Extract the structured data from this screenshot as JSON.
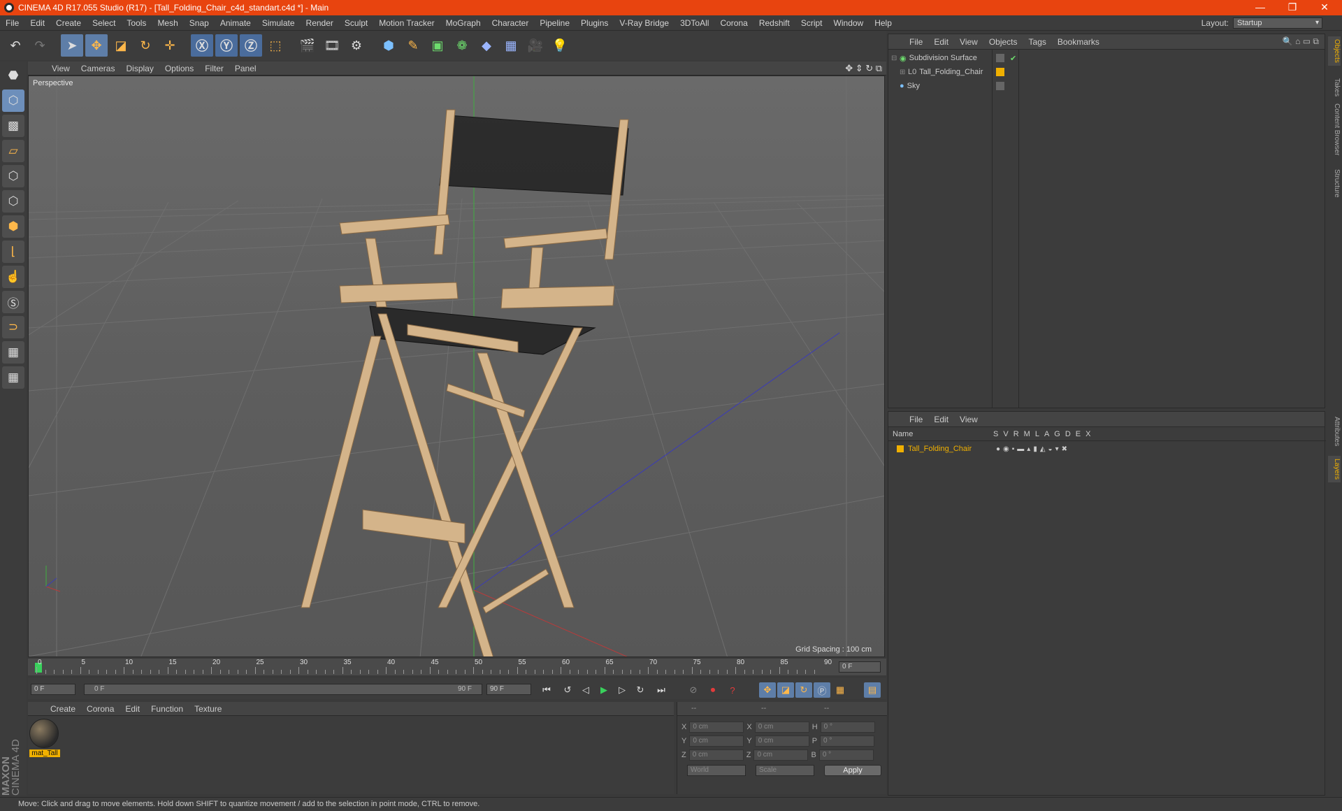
{
  "window": {
    "title": "CINEMA 4D R17.055 Studio (R17) - [Tall_Folding_Chair_c4d_standart.c4d *] - Main",
    "minimize": "—",
    "restore": "❐",
    "close": "✕"
  },
  "menu": [
    "File",
    "Edit",
    "Create",
    "Select",
    "Tools",
    "Mesh",
    "Snap",
    "Animate",
    "Simulate",
    "Render",
    "Sculpt",
    "Motion Tracker",
    "MoGraph",
    "Character",
    "Pipeline",
    "Plugins",
    "V-Ray Bridge",
    "3DToAll",
    "Corona",
    "Redshift",
    "Script",
    "Window",
    "Help"
  ],
  "layout": {
    "label": "Layout:",
    "value": "Startup"
  },
  "viewport": {
    "menu": [
      "View",
      "Cameras",
      "Display",
      "Options",
      "Filter",
      "Panel"
    ],
    "label": "Perspective",
    "grid_spacing": "Grid Spacing : 100 cm"
  },
  "timeline": {
    "ticks": [
      "0",
      "5",
      "10",
      "15",
      "20",
      "25",
      "30",
      "35",
      "40",
      "45",
      "50",
      "55",
      "60",
      "65",
      "70",
      "75",
      "80",
      "85",
      "90"
    ],
    "current_frame": "0 F",
    "start_field": "0 F",
    "range_start": "0 F",
    "range_end": "90 F",
    "end_field": "90 F"
  },
  "materials": {
    "menu": [
      "Create",
      "Corona",
      "Edit",
      "Function",
      "Texture"
    ],
    "items": [
      {
        "name": "mat_Tall"
      }
    ]
  },
  "coords": {
    "headers": [
      "--",
      "--",
      "--"
    ],
    "rows": [
      {
        "a": "X",
        "v1": "0 cm",
        "b": "X",
        "v2": "0 cm",
        "c": "H",
        "v3": "0 °"
      },
      {
        "a": "Y",
        "v1": "0 cm",
        "b": "Y",
        "v2": "0 cm",
        "c": "P",
        "v3": "0 °"
      },
      {
        "a": "Z",
        "v1": "0 cm",
        "b": "Z",
        "v2": "0 cm",
        "c": "B",
        "v3": "0 °"
      }
    ],
    "world": "World",
    "scale": "Scale",
    "apply": "Apply"
  },
  "objects": {
    "menu": [
      "File",
      "Edit",
      "View",
      "Objects",
      "Tags",
      "Bookmarks"
    ],
    "items": [
      {
        "name": "Subdivision Surface"
      },
      {
        "name": "Tall_Folding_Chair"
      },
      {
        "name": "Sky"
      }
    ]
  },
  "layers": {
    "menu": [
      "File",
      "Edit",
      "View"
    ],
    "name_header": "Name",
    "columns": [
      "S",
      "V",
      "R",
      "M",
      "L",
      "A",
      "G",
      "D",
      "E",
      "X"
    ],
    "items": [
      {
        "name": "Tall_Folding_Chair"
      }
    ]
  },
  "side_tabs": [
    "Objects",
    "Takes",
    "Content Browser",
    "Structure"
  ],
  "side_tabs_lower": [
    "Attributes",
    "Layers"
  ],
  "status": "Move: Click and drag to move elements. Hold down SHIFT to quantize movement / add to the selection in point mode, CTRL to remove.",
  "brand": {
    "maxon": "MAXON",
    "product": "CINEMA 4D"
  }
}
